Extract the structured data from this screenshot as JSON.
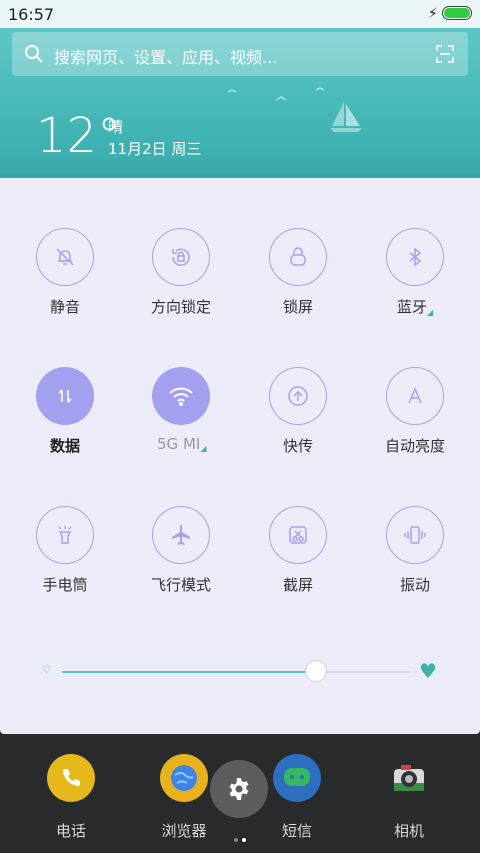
{
  "status": {
    "time": "16:57"
  },
  "search": {
    "placeholder": "搜索网页、设置、应用、视频..."
  },
  "weather": {
    "temp": "12°",
    "condition": "晴",
    "date": "11月2日 周三"
  },
  "tiles": [
    {
      "label": "静音",
      "icon": "mute-bell-icon",
      "active": false
    },
    {
      "label": "方向锁定",
      "icon": "rotation-lock-icon",
      "active": false
    },
    {
      "label": "锁屏",
      "icon": "lock-icon",
      "active": false
    },
    {
      "label": "蓝牙",
      "icon": "bluetooth-icon",
      "active": false
    },
    {
      "label": "数据",
      "icon": "data-transfer-icon",
      "active": true
    },
    {
      "label": " 5G    MI",
      "icon": "wifi-icon",
      "active": true
    },
    {
      "label": "快传",
      "icon": "upload-circle-icon",
      "active": false
    },
    {
      "label": "自动亮度",
      "icon": "auto-brightness-icon",
      "active": false
    },
    {
      "label": "手电筒",
      "icon": "flashlight-icon",
      "active": false
    },
    {
      "label": "飞行模式",
      "icon": "airplane-icon",
      "active": false
    },
    {
      "label": "截屏",
      "icon": "screenshot-icon",
      "active": false
    },
    {
      "label": "振动",
      "icon": "vibrate-icon",
      "active": false
    }
  ],
  "brightness": {
    "level": 0.73
  },
  "dock": {
    "apps": [
      {
        "name": "电话",
        "icon": "phone-icon",
        "color": "#f2c51e"
      },
      {
        "name": "浏览器",
        "icon": "browser-globe-icon",
        "color": "#3f83e8"
      },
      {
        "name": "短信",
        "icon": "message-icon",
        "color": "#35b85f"
      },
      {
        "name": "相机",
        "icon": "camera-icon",
        "color": "#d9d9d9"
      }
    ]
  },
  "colors": {
    "accent": "#a4a0f0",
    "teal": "#3bb3a7",
    "panel": "#ecebf8"
  }
}
